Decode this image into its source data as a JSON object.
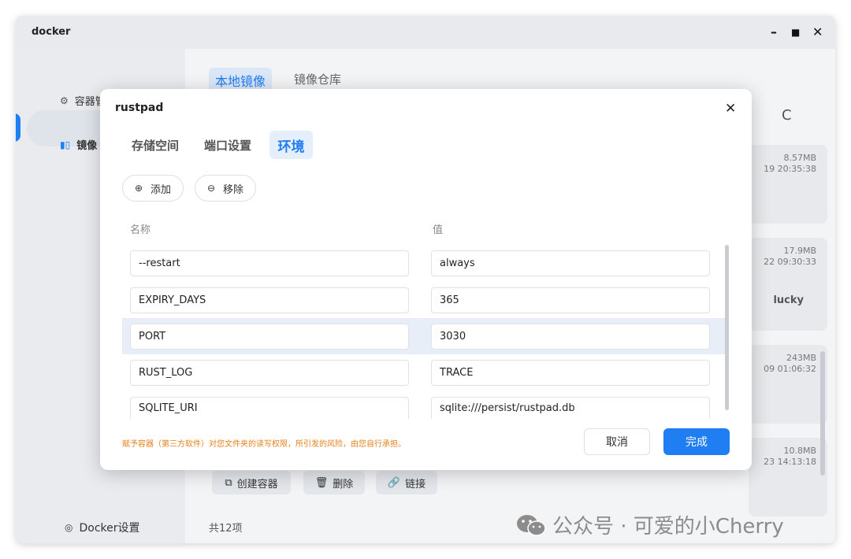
{
  "window": {
    "title": "docker",
    "controls": {
      "minimize": "–",
      "maximize": "■",
      "close": "✕"
    }
  },
  "sidebar": {
    "items": [
      {
        "label": "容器管理",
        "icon": "container-icon"
      },
      {
        "label": "镜像",
        "icon": "image-icon"
      }
    ],
    "settings_label": "Docker设置"
  },
  "main": {
    "tabs": [
      {
        "label": "本地镜像",
        "active": true
      },
      {
        "label": "镜像仓库",
        "active": false
      }
    ],
    "refresh_glyph": "C",
    "cards": [
      {
        "size": "8.57MB",
        "time": "19 20:35:38",
        "tag": ""
      },
      {
        "size": "17.9MB",
        "time": "22 09:30:33",
        "tag": "lucky"
      },
      {
        "size": "243MB",
        "time": "09 01:06:32",
        "tag": ""
      },
      {
        "size": "10.8MB",
        "time": "23 14:13:18",
        "tag": ""
      }
    ],
    "actions": [
      {
        "label": "创建容器",
        "icon": "create-container-icon"
      },
      {
        "label": "删除",
        "icon": "trash-icon"
      },
      {
        "label": "链接",
        "icon": "link-icon"
      }
    ],
    "count_label": "共12项"
  },
  "dialog": {
    "title": "rustpad",
    "close_glyph": "✕",
    "tabs": [
      {
        "label": "存储空间",
        "active": false
      },
      {
        "label": "端口设置",
        "active": false
      },
      {
        "label": "环境",
        "active": true
      }
    ],
    "add_label": "添加",
    "remove_label": "移除",
    "col_name": "名称",
    "col_value": "值",
    "env": [
      {
        "name": "--restart",
        "value": "always",
        "selected": false
      },
      {
        "name": "EXPIRY_DAYS",
        "value": "365",
        "selected": false
      },
      {
        "name": "PORT",
        "value": "3030",
        "selected": true
      },
      {
        "name": "RUST_LOG",
        "value": "TRACE",
        "selected": false
      },
      {
        "name": "SQLITE_URI",
        "value": "sqlite:///persist/rustpad.db",
        "selected": false
      }
    ],
    "warning": "赋予容器（第三方软件）对您文件夹的读写权限，所引发的风险，由您自行承担。",
    "cancel_label": "取消",
    "ok_label": "完成"
  },
  "watermark": {
    "text": "公众号 · 可爱的小Cherry"
  },
  "colors": {
    "accent": "#1f7ef2",
    "warning": "#e6801a",
    "selected_row": "#e7eef8"
  }
}
